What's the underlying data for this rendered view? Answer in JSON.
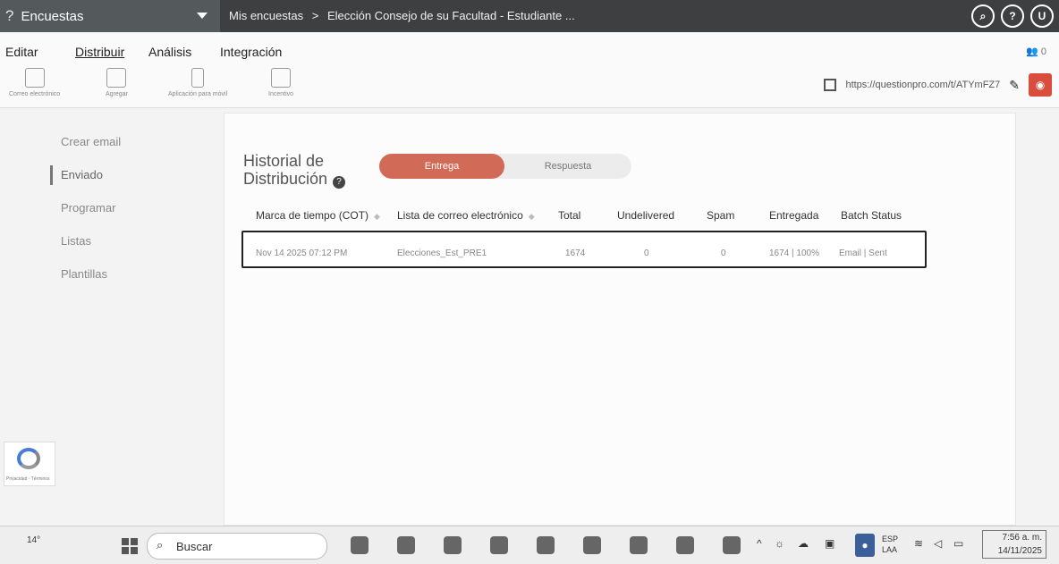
{
  "topbar": {
    "logo_icon": "questionpro-logo-icon",
    "app_name": "Encuestas",
    "breadcrumb": [
      "Mis encuestas",
      "Elección Consejo de su Facultad - Estudiante ..."
    ],
    "breadcrumb_sep": ">",
    "icons": [
      "search-icon",
      "help-icon",
      "user-icon"
    ],
    "icon_glyphs": [
      "⌕",
      "?",
      "U"
    ]
  },
  "menu": {
    "items": [
      "Editar",
      "Distribuir",
      "Análisis",
      "Integración"
    ],
    "active": "Distribuir",
    "right_text": "0"
  },
  "toolbar": {
    "tools": [
      "Correo electrónico",
      "Agregar",
      "Aplicación para móvil",
      "Incentivo"
    ],
    "url": "https://questionpro.com/t/ATYmFZ7"
  },
  "sidebar": {
    "items": [
      "Crear email",
      "Enviado",
      "Programar",
      "Listas",
      "Plantillas"
    ],
    "active": "Enviado"
  },
  "main": {
    "title_line1": "Historial de",
    "title_line2": "Distribución",
    "toggle": [
      "Entrega",
      "Respuesta"
    ],
    "active_toggle": "Entrega",
    "columns": [
      "Marca de tiempo (COT)",
      "Lista de correo electrónico",
      "Total",
      "Undelivered",
      "Spam",
      "Entregada",
      "Batch Status"
    ],
    "rows": [
      [
        "Nov 14 2025 07:12 PM",
        "Elecciones_Est_PRE1",
        "1674",
        "0",
        "0",
        "1674 | 100%",
        "Email | Sent"
      ]
    ]
  },
  "recaptcha": {
    "label": "Privacidad - Términos"
  },
  "taskbar": {
    "temperature": "14°",
    "search_label": "Buscar",
    "lang_line1": "ESP",
    "lang_line2": "LAA",
    "time": "7:56 a. m.",
    "date": "14/11/2025"
  },
  "colors": {
    "topbar": "#3d3f41",
    "brand": "#54595c",
    "accent": "#d84d3c",
    "toggle_active": "#d26a58"
  }
}
